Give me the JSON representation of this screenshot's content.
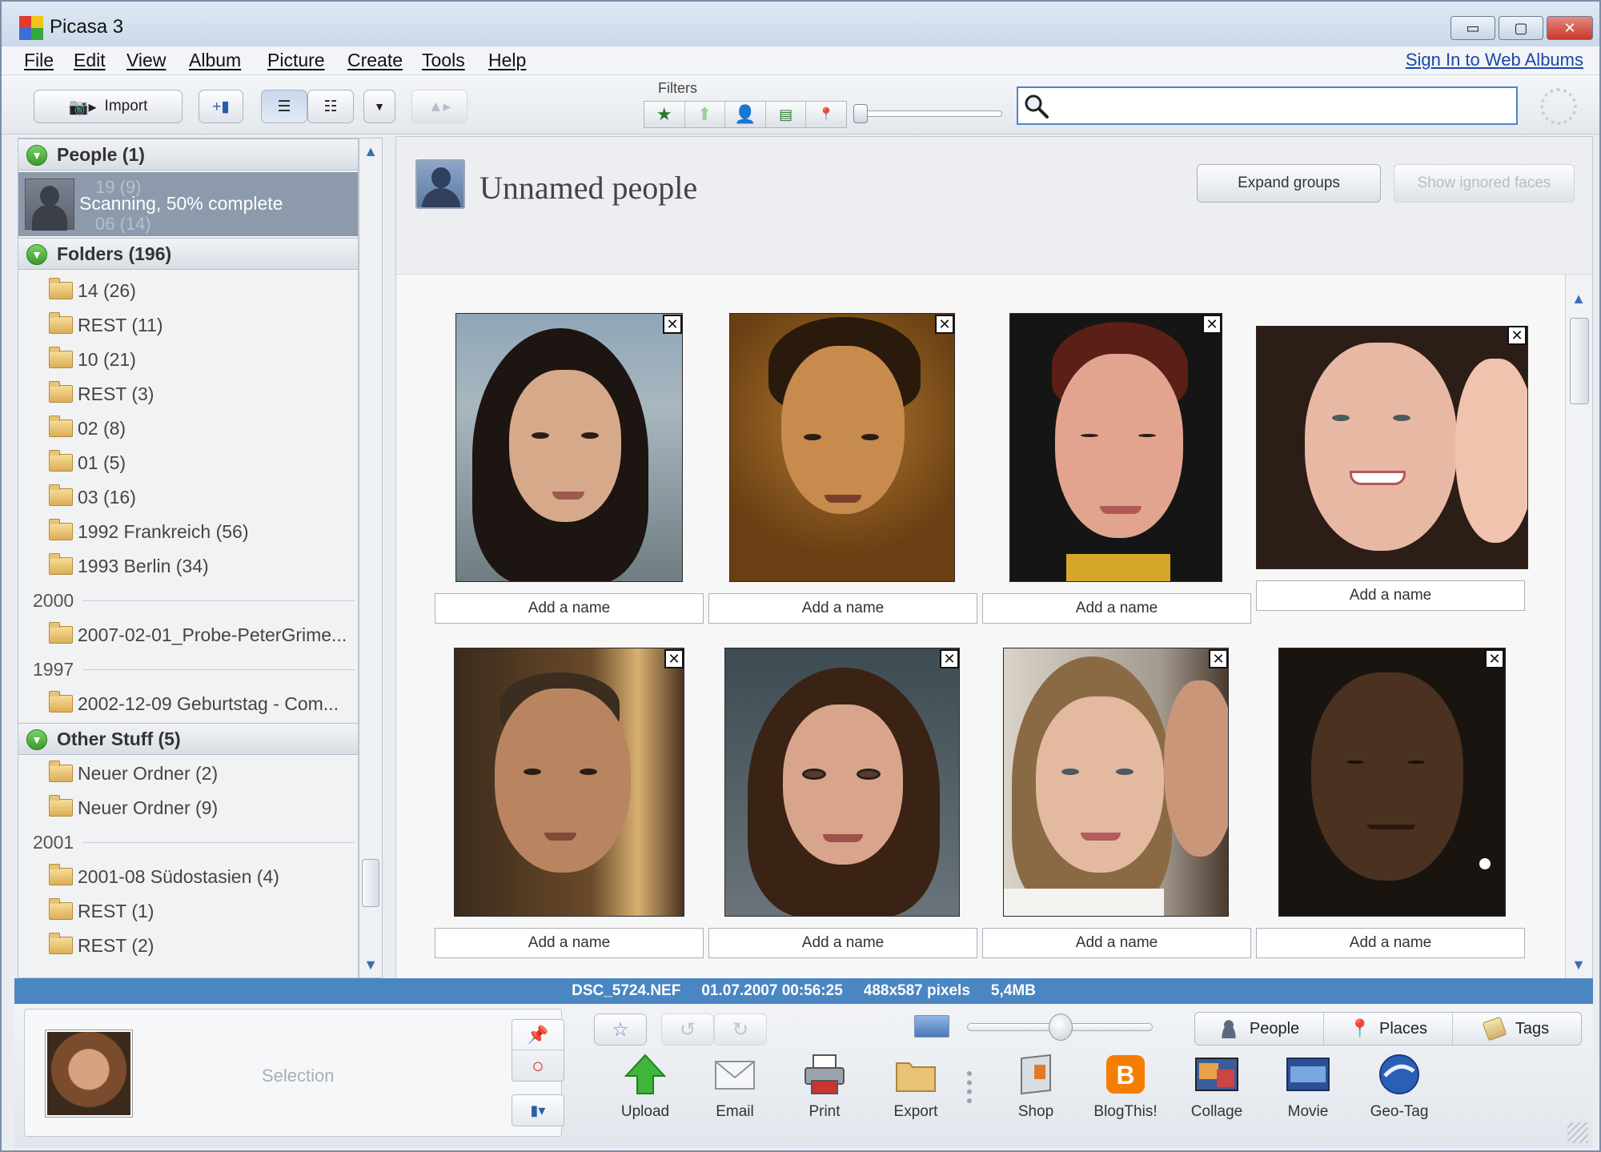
{
  "window": {
    "title": "Picasa 3"
  },
  "menubar": {
    "items": [
      "File",
      "Edit",
      "View",
      "Album",
      "Picture",
      "Create",
      "Tools",
      "Help"
    ],
    "signin": "Sign In to Web Albums"
  },
  "toolbar": {
    "import_label": "Import",
    "filters_label": "Filters",
    "search_placeholder": ""
  },
  "sidebar": {
    "people": {
      "header": "People (1)",
      "scanning": "Scanning, 50% complete",
      "ghost_top": "19 (9)",
      "ghost_bottom": "06 (14)"
    },
    "folders": {
      "header": "Folders (196)",
      "items": [
        "14 (26)",
        "REST (11)",
        "10 (21)",
        "REST (3)",
        "02 (8)",
        "01 (5)",
        "03 (16)",
        "1992 Frankreich (56)",
        "1993 Berlin (34)"
      ],
      "year_2000": "2000",
      "item_2000": "2007-02-01_Probe-PeterGrime...",
      "year_1997": "1997",
      "item_1997": "2002-12-09 Geburtstag - Com..."
    },
    "other": {
      "header": "Other Stuff (5)",
      "items": [
        "Neuer Ordner (2)",
        "Neuer Ordner (9)"
      ],
      "year_2001": "2001",
      "items_2001": [
        "2001-08 Südostasien (4)",
        "REST (1)",
        "REST (2)"
      ]
    }
  },
  "main": {
    "title": "Unnamed people",
    "expand_button": "Expand groups",
    "ignored_button": "Show ignored faces",
    "faces": [
      {
        "name_placeholder": "Add a name"
      },
      {
        "name_placeholder": "Add a name"
      },
      {
        "name_placeholder": "Add a name"
      },
      {
        "name_placeholder": "Add a name"
      },
      {
        "name_placeholder": "Add a name"
      },
      {
        "name_placeholder": "Add a name"
      },
      {
        "name_placeholder": "Add a name"
      },
      {
        "name_placeholder": "Add a name"
      }
    ]
  },
  "status": {
    "filename": "DSC_5724.NEF",
    "datetime": "01.07.2007 00:56:25",
    "dimensions": "488x587 pixels",
    "filesize": "5,4MB"
  },
  "tray": {
    "selection_label": "Selection",
    "tabs": [
      "People",
      "Places",
      "Tags"
    ],
    "actions": [
      "Upload",
      "Email",
      "Print",
      "Export",
      "Shop",
      "BlogThis!",
      "Collage",
      "Movie",
      "Geo-Tag"
    ]
  },
  "colors": {
    "status_bar": "#4a86c2",
    "accent_green": "#3a9a2a",
    "link_blue": "#1a49a8"
  }
}
